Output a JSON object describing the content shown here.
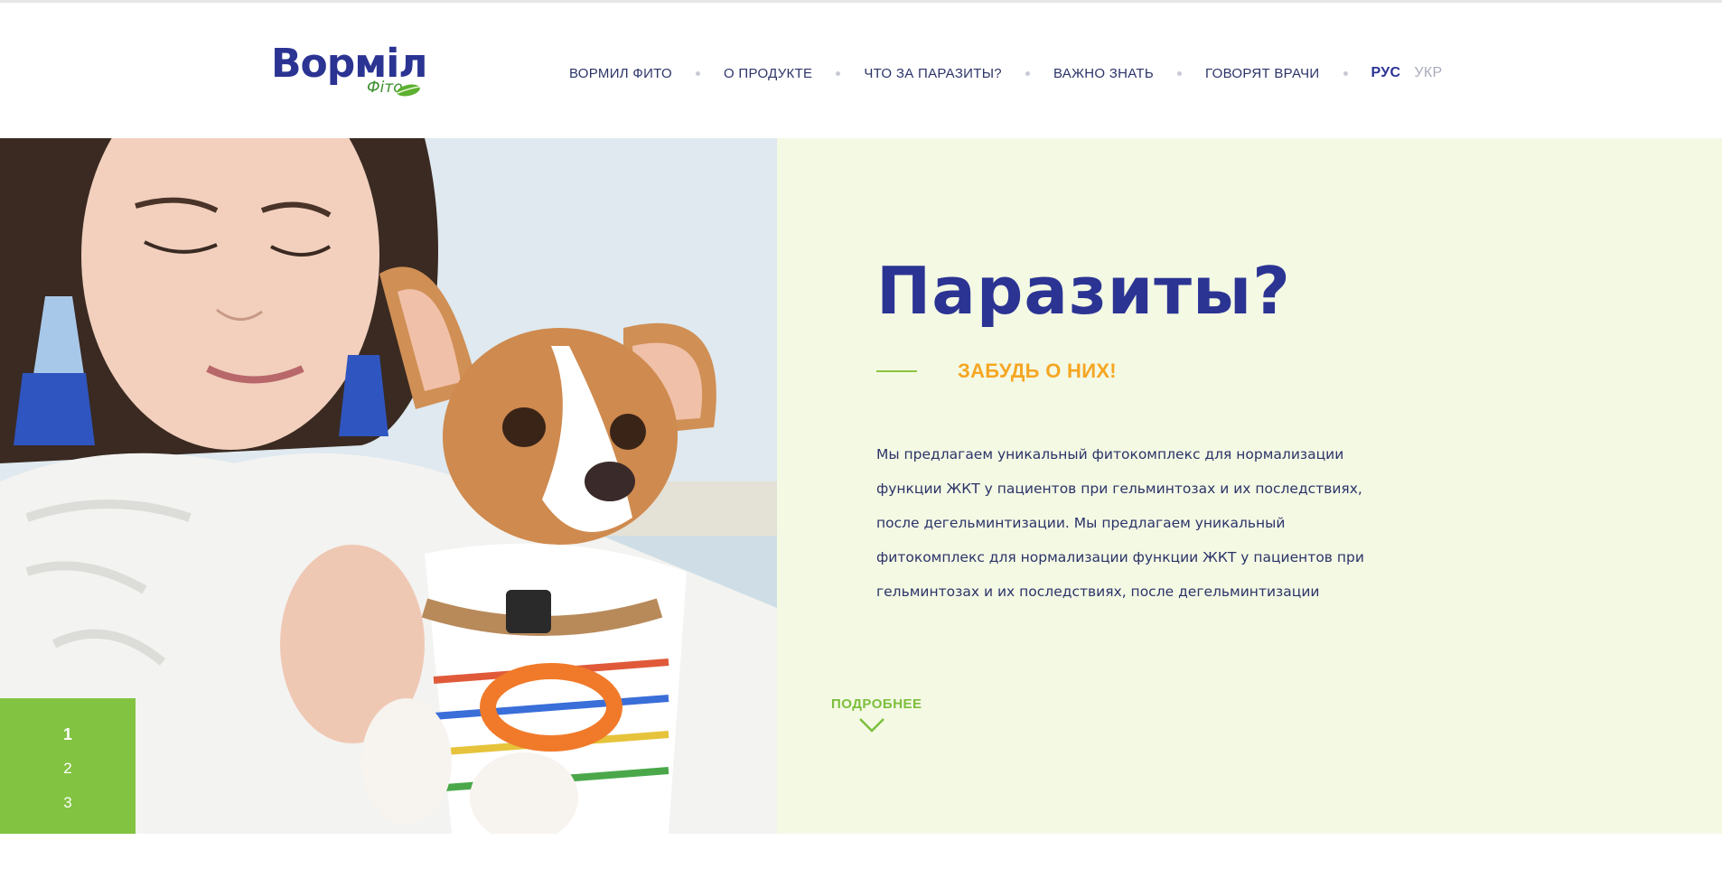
{
  "brand": {
    "name": "Ворміл",
    "sub": "Фіто"
  },
  "nav": {
    "items": [
      {
        "label": "ВОРМИЛ ФИТО"
      },
      {
        "label": "О ПРОДУКТЕ"
      },
      {
        "label": "ЧТО ЗА ПАРАЗИТЫ?"
      },
      {
        "label": "ВАЖНО ЗНАТЬ"
      },
      {
        "label": "ГОВОРЯТ ВРАЧИ"
      }
    ],
    "lang_active": "Рус",
    "lang_other": "Укр"
  },
  "hero": {
    "title": "Паразиты?",
    "subtitle": "ЗАБУДЬ О НИХ!",
    "description": "Мы предлагаем уникальный фитокомплекс для нормализации функции ЖКТ у пациентов при гельминтозах и их последствиях, после дегельминтизации. Мы предлагаем уникальный фитокомплекс для нормализации функции ЖКТ у пациентов при гельминтозах и их последствиях, после дегельминтизации",
    "more_label": "ПОДРОБНЕЕ",
    "image_icon": "photo-woman-with-dog"
  },
  "pager": {
    "items": [
      "1",
      "2",
      "3"
    ],
    "active": "1"
  },
  "colors": {
    "brand_blue": "#2b3493",
    "accent_green": "#82c341",
    "accent_orange": "#f5a623",
    "panel_bg": "#f4f9e4"
  }
}
